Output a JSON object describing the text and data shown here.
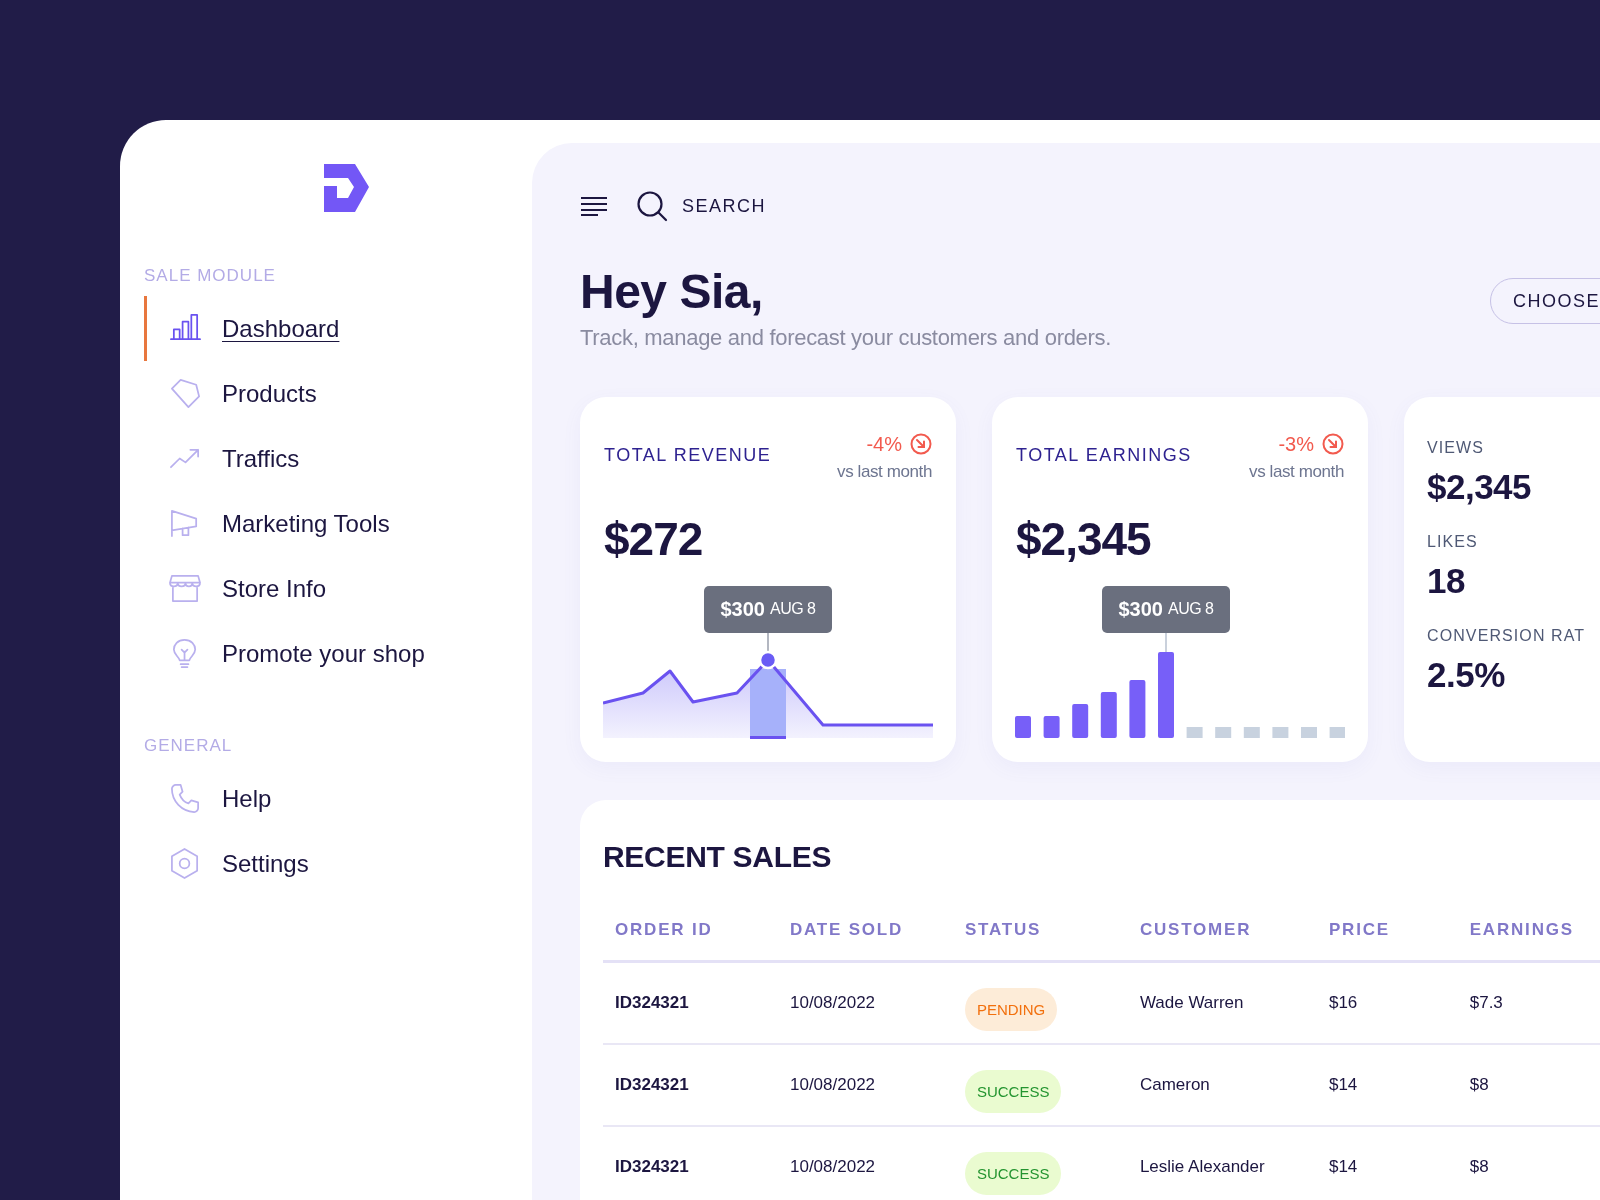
{
  "sidebar": {
    "sections": [
      {
        "title": "SALE MODULE",
        "items": [
          {
            "label": "Dashboard",
            "selected": true
          },
          {
            "label": "Products",
            "selected": false
          },
          {
            "label": "Traffics",
            "selected": false
          },
          {
            "label": "Marketing Tools",
            "selected": false
          },
          {
            "label": "Store Info",
            "selected": false
          },
          {
            "label": "Promote your shop",
            "selected": false
          }
        ]
      },
      {
        "title": "GENERAL",
        "items": [
          {
            "label": "Help",
            "selected": false
          },
          {
            "label": "Settings",
            "selected": false
          }
        ]
      }
    ]
  },
  "search": {
    "placeholder": "SEARCH"
  },
  "greeting": {
    "title": "Hey Sia,",
    "subtitle": "Track, manage and forecast your customers and orders."
  },
  "choose_button": "CHOOSE",
  "cards": [
    {
      "kind": "area",
      "title": "TOTAL REVENUE",
      "change": "-4%",
      "comparison": "vs last month",
      "value": "$272",
      "tooltip": {
        "value": "$300",
        "label": "AUG 8"
      }
    },
    {
      "kind": "bar",
      "title": "TOTAL EARNINGS",
      "change": "-3%",
      "comparison": "vs last month",
      "value": "$2,345",
      "tooltip": {
        "value": "$300",
        "label": "AUG 8"
      }
    }
  ],
  "stats": [
    {
      "label": "VIEWS",
      "value": "$2,345"
    },
    {
      "label": "LIKES",
      "value": "18"
    },
    {
      "label": "CONVERSION RAT",
      "value": "2.5%"
    }
  ],
  "recent_sales": {
    "title": "RECENT SALES",
    "columns": [
      "ORDER ID",
      "DATE SOLD",
      "STATUS",
      "CUSTOMER",
      "PRICE",
      "EARNINGS"
    ],
    "rows": [
      {
        "order_id": "ID324321",
        "date_sold": "10/08/2022",
        "status": {
          "label": "PENDING",
          "kind": "pending"
        },
        "customer": "Wade Warren",
        "price": "$16",
        "earnings": "$7.3"
      },
      {
        "order_id": "ID324321",
        "date_sold": "10/08/2022",
        "status": {
          "label": "SUCCESS",
          "kind": "success"
        },
        "customer": "Cameron",
        "price": "$14",
        "earnings": "$8"
      },
      {
        "order_id": "ID324321",
        "date_sold": "10/08/2022",
        "status": {
          "label": "SUCCESS",
          "kind": "success"
        },
        "customer": "Leslie Alexander",
        "price": "$14",
        "earnings": "$8"
      }
    ]
  }
}
